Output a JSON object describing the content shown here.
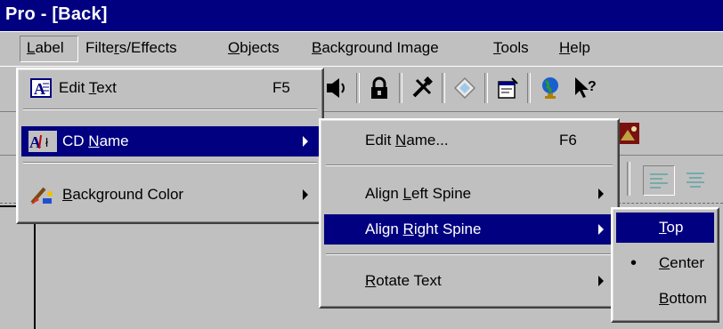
{
  "window": {
    "title": "Pro - [Back]"
  },
  "menubar": {
    "items": [
      {
        "pre": "",
        "key": "L",
        "post": "abel"
      },
      {
        "pre": "Filte",
        "key": "r",
        "post": "s/Effects"
      },
      {
        "pre": "",
        "key": "O",
        "post": "bjects"
      },
      {
        "pre": "",
        "key": "B",
        "post": "ackground Image"
      },
      {
        "pre": "",
        "key": "T",
        "post": "ools"
      },
      {
        "pre": "",
        "key": "H",
        "post": "elp"
      }
    ]
  },
  "label_menu": {
    "items": [
      {
        "pre": "Edit ",
        "key": "T",
        "post": "ext",
        "shortcut": "F5",
        "icon": "text-a-icon"
      },
      {
        "pre": "CD ",
        "key": "N",
        "post": "ame",
        "icon": "cd-text-icon"
      },
      {
        "pre": "",
        "key": "B",
        "post": "ackground Color",
        "icon": "paint-brush-icon"
      }
    ]
  },
  "cd_name_menu": {
    "items": [
      {
        "pre": "Edit ",
        "key": "N",
        "post": "ame...",
        "shortcut": "F6"
      },
      {
        "pre": "Align ",
        "key": "L",
        "post": "eft Spine"
      },
      {
        "pre": "Align ",
        "key": "R",
        "post": "ight Spine"
      },
      {
        "pre": "",
        "key": "R",
        "post": "otate Text"
      }
    ]
  },
  "align_right_menu": {
    "items": [
      {
        "pre": "",
        "key": "T",
        "post": "op"
      },
      {
        "pre": "",
        "key": "C",
        "post": "enter",
        "bullet": "•"
      },
      {
        "pre": "",
        "key": "B",
        "post": "ottom"
      }
    ]
  },
  "colors": {
    "selection": "#000080",
    "face": "#c0c0c0"
  }
}
